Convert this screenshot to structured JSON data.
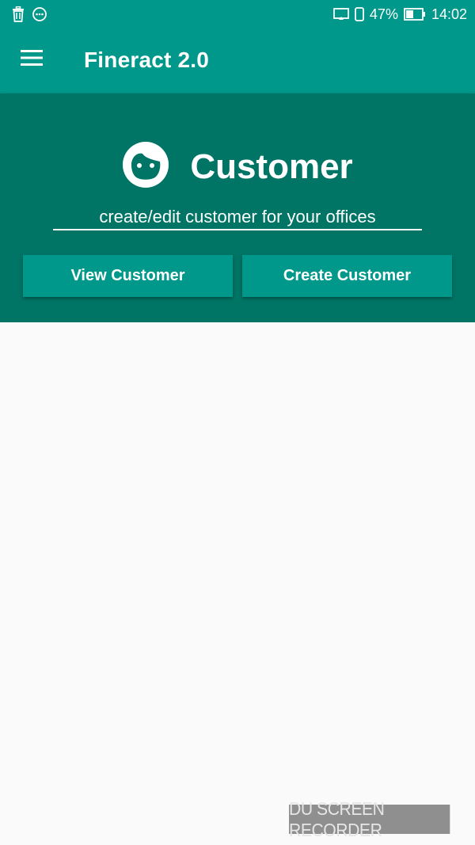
{
  "status_bar": {
    "icons": [
      "trash-icon",
      "chat-bubble-icon",
      "cast-icon",
      "phone-icon",
      "battery-icon"
    ],
    "battery": "47%",
    "time": "14:02"
  },
  "app_bar": {
    "title": "Fineract 2.0",
    "menu_icon": "hamburger-menu-icon"
  },
  "customer_card": {
    "icon": "face-icon",
    "heading": "Customer",
    "subtitle": "create/edit customer for your offices",
    "buttons": {
      "view": "View Customer",
      "create": "Create Customer"
    }
  },
  "watermark": "DU SCREEN RECORDER",
  "colors": {
    "primary": "#00988a",
    "card": "#007565",
    "background": "#fafafa",
    "text_on_primary": "#ffffff"
  }
}
